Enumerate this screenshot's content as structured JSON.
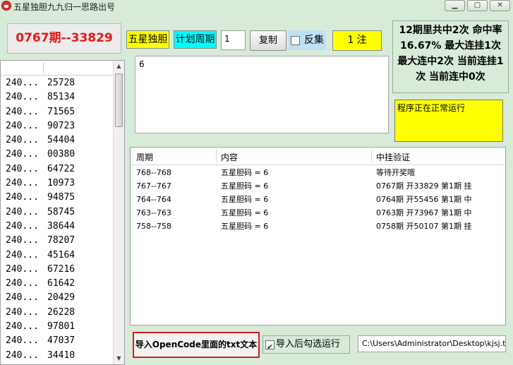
{
  "window": {
    "title": "五星独胆九九归一思路出号",
    "controls": [
      "minimize-icon",
      "maximize-icon",
      "close-icon"
    ]
  },
  "issue_display": "0767期--33829",
  "toolbar": {
    "mode_label": "五星独胆",
    "plan_period_label": "计划周期",
    "period_value": "1",
    "copy_label": "复制",
    "reverse_label": "反集",
    "reverse_checked": false,
    "bet_count": "1 注"
  },
  "stats_text": "12期里共中2次 命中率16.67% 最大连挂1次 最大连中2次 当前连挂1次 当前连中0次",
  "status_text": "程序正在正常运行",
  "input_text": "6",
  "history": [
    {
      "period": "240...",
      "number": "25728"
    },
    {
      "period": "240...",
      "number": "85134"
    },
    {
      "period": "240...",
      "number": "71565"
    },
    {
      "period": "240...",
      "number": "90723"
    },
    {
      "period": "240...",
      "number": "54404"
    },
    {
      "period": "240...",
      "number": "00380"
    },
    {
      "period": "240...",
      "number": "64722"
    },
    {
      "period": "240...",
      "number": "10973"
    },
    {
      "period": "240...",
      "number": "94875"
    },
    {
      "period": "240...",
      "number": "58745"
    },
    {
      "period": "240...",
      "number": "38644"
    },
    {
      "period": "240...",
      "number": "78207"
    },
    {
      "period": "240...",
      "number": "45164"
    },
    {
      "period": "240...",
      "number": "67216"
    },
    {
      "period": "240...",
      "number": "61642"
    },
    {
      "period": "240...",
      "number": "20429"
    },
    {
      "period": "240...",
      "number": "26228"
    },
    {
      "period": "240...",
      "number": "97801"
    },
    {
      "period": "240...",
      "number": "47037"
    },
    {
      "period": "240...",
      "number": "34410"
    }
  ],
  "results": {
    "columns": [
      "周期",
      "内容",
      "中挂验证"
    ],
    "rows": [
      {
        "period": "768--768",
        "content": "五星胆码 = 6",
        "check": "等待开奖哦"
      },
      {
        "period": "767--767",
        "content": "五星胆码 = 6",
        "check": "0767期 开33829 第1期 挂"
      },
      {
        "period": "764--764",
        "content": "五星胆码 = 6",
        "check": "0764期 开55456 第1期 中"
      },
      {
        "period": "763--763",
        "content": "五星胆码 = 6",
        "check": "0763期 开73967 第1期 中"
      },
      {
        "period": "758--758",
        "content": "五星胆码 = 6",
        "check": "0758期 开50107 第1期 挂"
      }
    ]
  },
  "bottom": {
    "import_label": "导入OpenCode里面的txt文本",
    "run_after_label": "导入后勾选运行",
    "run_after_checked": true,
    "file_path": "C:\\Users\\Administrator\\Desktop\\kjsj.t"
  },
  "colors": {
    "background": "#d8ead8",
    "issue_red": "#e81818",
    "highlight_yellow": "#ffff00",
    "highlight_cyan": "#00ffff",
    "import_border": "#d02020"
  }
}
